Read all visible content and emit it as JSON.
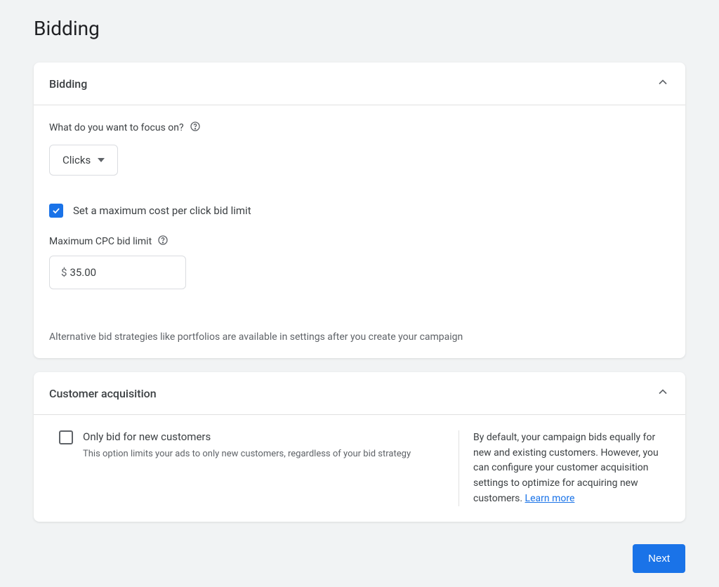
{
  "page": {
    "title": "Bidding"
  },
  "bidding": {
    "header": "Bidding",
    "focus_label": "What do you want to focus on?",
    "focus_value": "Clicks",
    "max_cpc_checkbox_label": "Set a maximum cost per click bid limit",
    "max_cpc_label": "Maximum CPC bid limit",
    "currency_symbol": "$",
    "max_cpc_value": "35.00",
    "footnote": "Alternative bid strategies like portfolios are available in settings after you create your campaign"
  },
  "acquisition": {
    "header": "Customer acquisition",
    "option_title": "Only bid for new customers",
    "option_desc": "This option limits your ads to only new customers, regardless of your bid strategy",
    "info_text": "By default, your campaign bids equally for new and existing customers. However, you can configure your customer acquisition settings to optimize for acquiring new customers. ",
    "learn_more": "Learn more"
  },
  "footer": {
    "next": "Next"
  }
}
